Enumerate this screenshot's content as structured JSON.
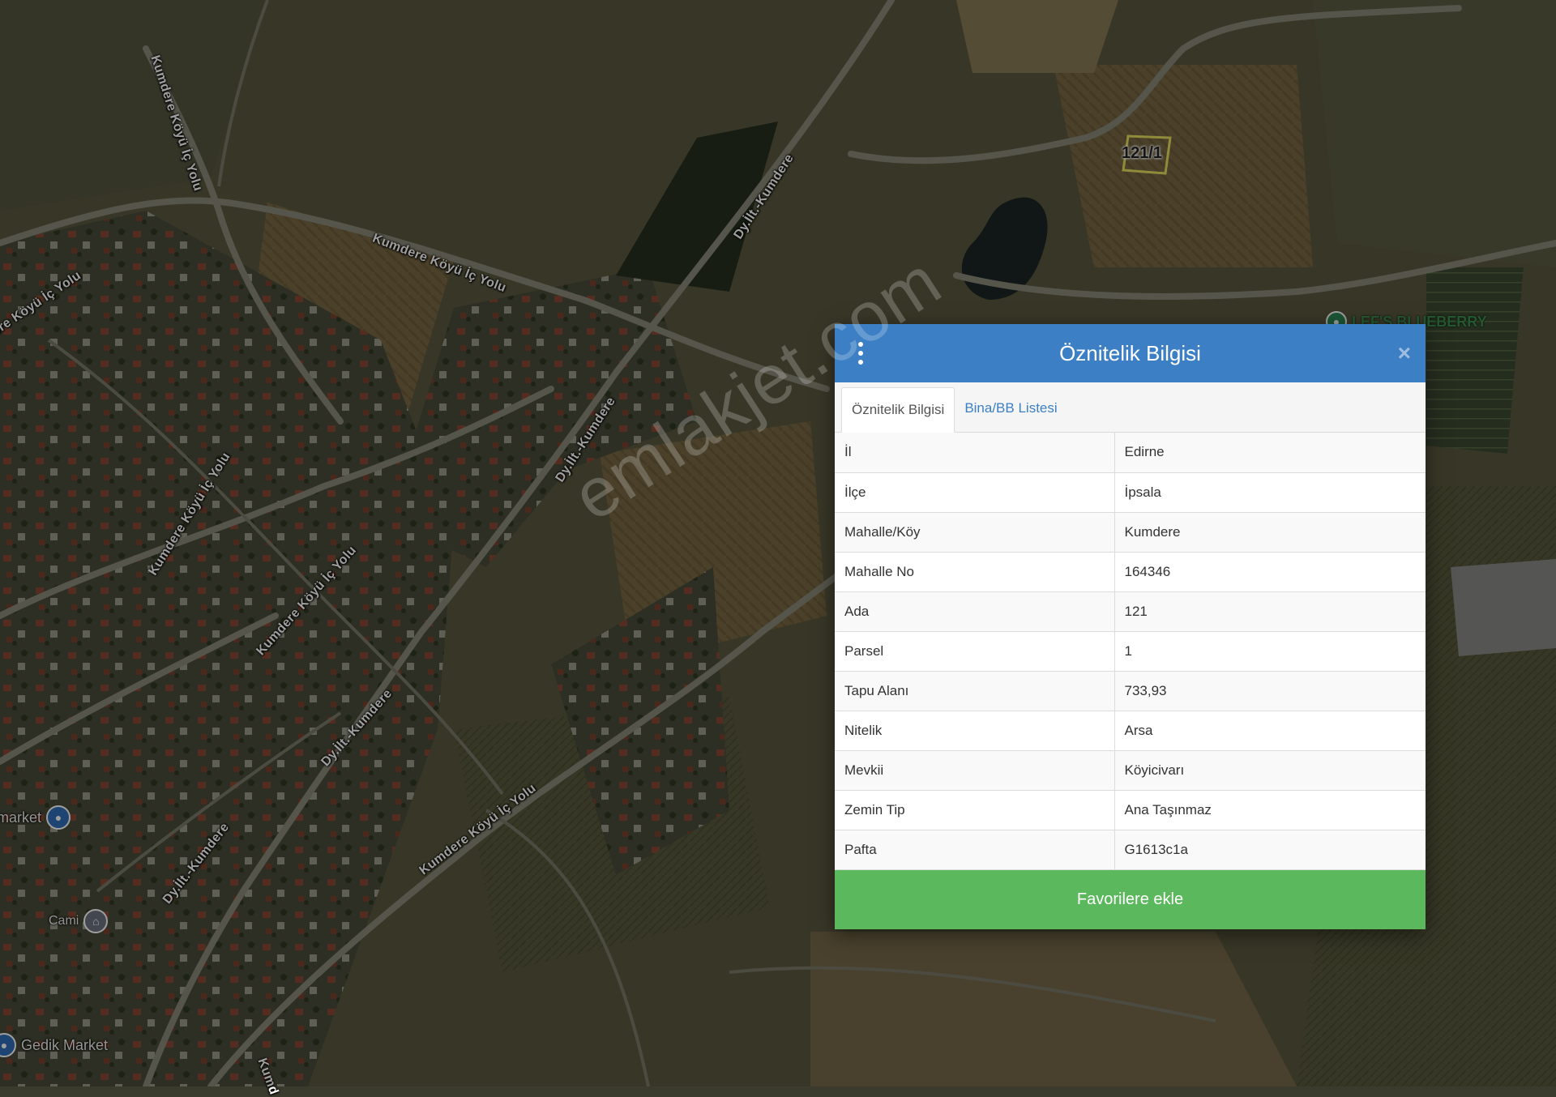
{
  "map": {
    "road_labels": [
      "Kumdere Köyü İç Yolu",
      "Kumdere Köyü İç Yolu",
      "ere Köyü İç Yolu",
      "Dy.İlt.-Kumdere",
      "Dy.İlt.-Kumdere",
      "Kumdere Köyü İç Yolu",
      "Kumdere Köyü İç Yolu",
      "Dy.İlt.-Kumdere",
      "Kumdere Köyü İç Yolu",
      "Dy.İlt.-Kumdere",
      "Kumd"
    ],
    "parcel_label": "121/1",
    "pois": {
      "market": "market",
      "cami": "Cami",
      "gedik": "Gedik Market",
      "blueberry": "LEF'S BLUEBERRY"
    }
  },
  "watermark": "emlakjet.com",
  "modal": {
    "title": "Öznitelik Bilgisi",
    "close_symbol": "×",
    "tabs": [
      "Öznitelik Bilgisi",
      "Bina/BB Listesi"
    ],
    "rows": [
      {
        "key": "İl",
        "value": "Edirne"
      },
      {
        "key": "İlçe",
        "value": "İpsala"
      },
      {
        "key": "Mahalle/Köy",
        "value": "Kumdere"
      },
      {
        "key": "Mahalle No",
        "value": "164346"
      },
      {
        "key": "Ada",
        "value": "121"
      },
      {
        "key": "Parsel",
        "value": "1"
      },
      {
        "key": "Tapu Alanı",
        "value": "733,93"
      },
      {
        "key": "Nitelik",
        "value": "Arsa"
      },
      {
        "key": "Mevkii",
        "value": "Köyicivarı"
      },
      {
        "key": "Zemin Tip",
        "value": "Ana Taşınmaz"
      },
      {
        "key": "Pafta",
        "value": "G1613c1a"
      }
    ],
    "favorite_button": "Favorilere ekle"
  },
  "colors": {
    "header": "#3c7fc4",
    "button": "#5cb85c",
    "link": "#3c7fc4"
  },
  "icons": [
    "kebab-menu-icon",
    "close-icon",
    "lock-icon",
    "mosque-icon",
    "pin-icon"
  ]
}
